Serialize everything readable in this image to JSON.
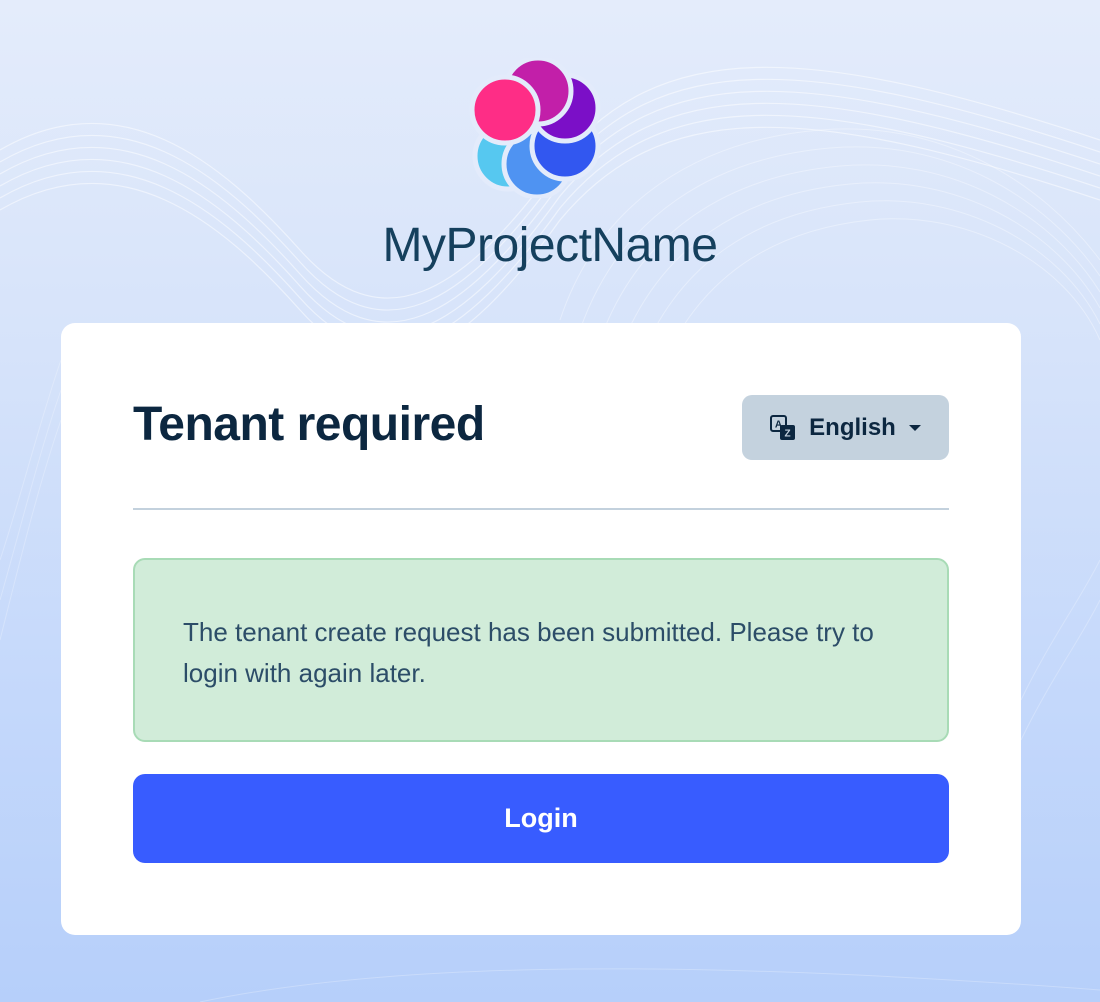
{
  "brand": {
    "name": "MyProjectName",
    "logo_icon": "flower-logo-icon",
    "logo_colors": [
      "#fe2d86",
      "#c21fa9",
      "#7b0fc7",
      "#56c8f0",
      "#4f93f2",
      "#3257f0"
    ]
  },
  "card": {
    "title": "Tenant required",
    "language": {
      "icon": "translate-icon",
      "label": "English",
      "caret_icon": "caret-down-icon"
    },
    "alert": {
      "message": "The tenant create request has been submitted. Please try to login with again later."
    },
    "login_label": "Login"
  },
  "colors": {
    "primary": "#385cff",
    "alert_bg": "#d1ecd9",
    "alert_border": "#a8dbb6",
    "title": "#0c2740",
    "brand_text": "#15405d"
  }
}
